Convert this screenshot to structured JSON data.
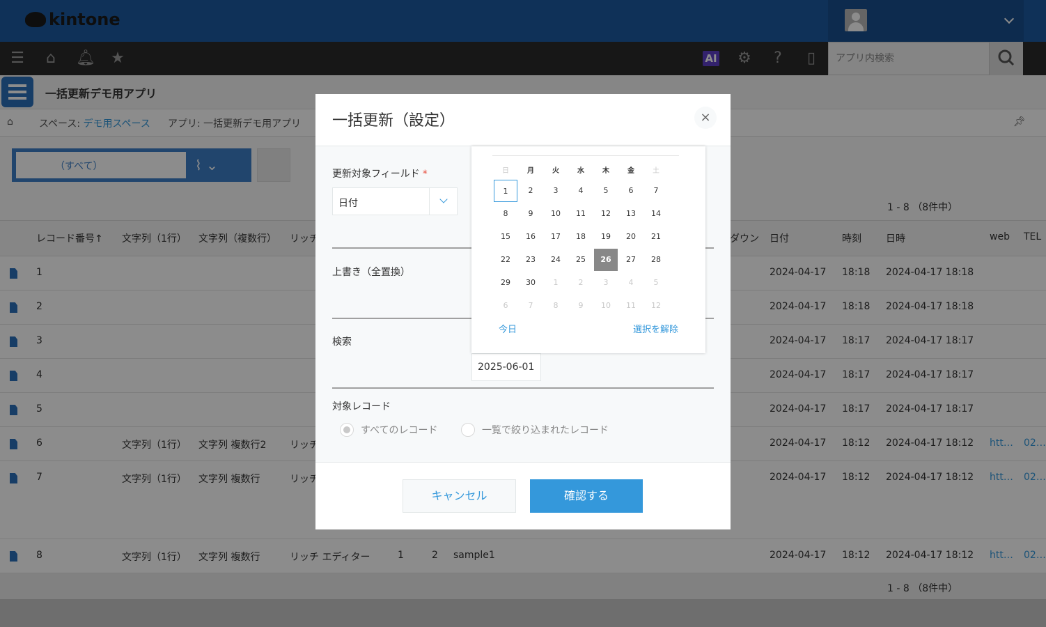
{
  "header": {
    "logo_text": "kintone"
  },
  "nav": {
    "ai_label": "AI",
    "search_placeholder": "アプリ内検索"
  },
  "app": {
    "title": "一括更新デモ用アプリ"
  },
  "breadcrumb": {
    "space_prefix": "スペース: ",
    "space_name": "デモ用スペース",
    "app_label": "アプリ: 一括更新デモ用アプリ"
  },
  "toolbar": {
    "view_name": "（すべて）",
    "count_top": "1 - 8 （8件中）",
    "count_bottom": "1 - 8 （8件中）"
  },
  "table": {
    "headers": {
      "record_no": "レコード番号↑",
      "str1": "文字列（1行）",
      "strm": "文字列（複数行）",
      "rich": "リッチ",
      "dropdown": "ダウン",
      "date": "日付",
      "time": "時刻",
      "datetime": "日時",
      "web": "web",
      "tel": "TEL"
    },
    "rows": [
      {
        "no": "1",
        "str1": "",
        "strm": "",
        "rich": "",
        "date": "2024-04-17",
        "time": "18:18",
        "datetime": "2024-04-17 18:18",
        "web": "",
        "tel": ""
      },
      {
        "no": "2",
        "str1": "",
        "strm": "",
        "rich": "",
        "date": "2024-04-17",
        "time": "18:18",
        "datetime": "2024-04-17 18:18",
        "web": "",
        "tel": ""
      },
      {
        "no": "3",
        "str1": "",
        "strm": "",
        "rich": "",
        "date": "2024-04-17",
        "time": "18:17",
        "datetime": "2024-04-17 18:17",
        "web": "",
        "tel": ""
      },
      {
        "no": "4",
        "str1": "",
        "strm": "",
        "rich": "",
        "date": "2024-04-17",
        "time": "18:17",
        "datetime": "2024-04-17 18:17",
        "web": "",
        "tel": ""
      },
      {
        "no": "5",
        "str1": "",
        "strm": "",
        "rich": "",
        "date": "2024-04-17",
        "time": "18:17",
        "datetime": "2024-04-17 18:17",
        "web": "",
        "tel": ""
      },
      {
        "no": "6",
        "str1": "文字列（1行）",
        "strm": "文字列 複数行2",
        "rich": "リッチ",
        "date": "2024-04-17",
        "time": "18:12",
        "datetime": "2024-04-17 18:12",
        "web": "htt…",
        "tel": "02…"
      },
      {
        "no": "7",
        "str1": "文字列（1行）",
        "strm": "文字列 複数行",
        "rich": "リッチ",
        "date": "2024-04-17",
        "time": "18:12",
        "datetime": "2024-04-17 18:12",
        "web": "htt…",
        "tel": "02…"
      },
      {
        "no": "8",
        "str1": "文字列（1行）",
        "strm": "文字列 複数行",
        "rich": "リッチ エディター",
        "num1": "1",
        "num2": "2",
        "text": "sample1",
        "date": "2024-04-17",
        "time": "18:12",
        "datetime": "2024-04-17 18:12",
        "web": "htt…",
        "tel": "02…"
      }
    ]
  },
  "dialog": {
    "title": "一括更新（設定）",
    "close_label": "×",
    "target_field_label": "更新対象フィールド",
    "required_mark": "*",
    "target_field_value": "日付",
    "overwrite_label": "上書き（全置換）",
    "search_label": "検索",
    "search_date_value": "2025-06-01",
    "target_records_label": "対象レコード",
    "radio_all": "すべてのレコード",
    "radio_filtered": "一覧で絞り込まれたレコード",
    "cancel_label": "キャンセル",
    "confirm_label": "確認する"
  },
  "calendar": {
    "weekdays": [
      "日",
      "月",
      "火",
      "水",
      "木",
      "金",
      "土"
    ],
    "weeks": [
      [
        "1",
        "2",
        "3",
        "4",
        "5",
        "6",
        "7"
      ],
      [
        "8",
        "9",
        "10",
        "11",
        "12",
        "13",
        "14"
      ],
      [
        "15",
        "16",
        "17",
        "18",
        "19",
        "20",
        "21"
      ],
      [
        "22",
        "23",
        "24",
        "25",
        "26",
        "27",
        "28"
      ],
      [
        "29",
        "30",
        "1",
        "2",
        "3",
        "4",
        "5"
      ],
      [
        "6",
        "7",
        "8",
        "9",
        "10",
        "11",
        "12"
      ]
    ],
    "today_day": "1",
    "selected_day": "26",
    "today_link": "今日",
    "clear_link": "選択を解除"
  }
}
